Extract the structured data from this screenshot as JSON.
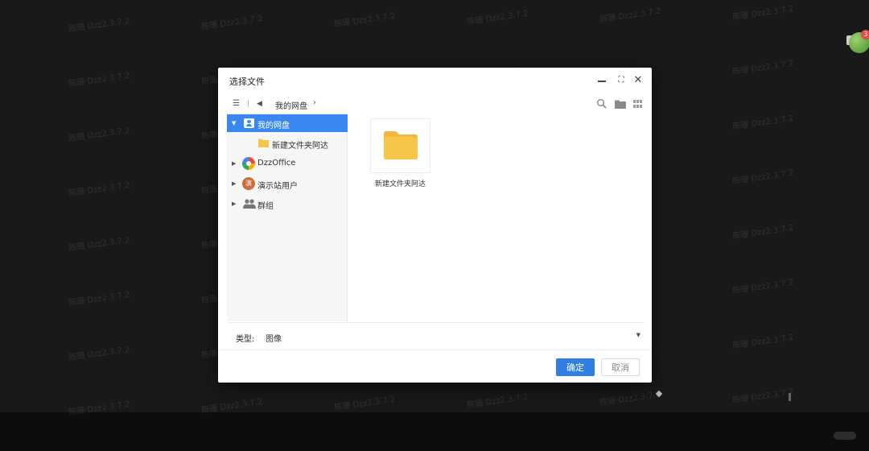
{
  "watermark": {
    "text": "陈珊 Dzz2.3.7.2"
  },
  "corner": {
    "badge": "3"
  },
  "dialog": {
    "title": "选择文件",
    "window_controls": {
      "minimize": "",
      "maximize": "⛶",
      "close": "✕"
    }
  },
  "toolbar": {
    "menu_icon": "menu-icon",
    "separator": "|",
    "back_icon": "back-arrow-icon",
    "breadcrumb": "我的网盘",
    "breadcrumb_chevron": "›",
    "right_icons": [
      "search-icon",
      "folder-icon",
      "grid-view-icon"
    ]
  },
  "sidebar": {
    "items": [
      {
        "label": "我的网盘",
        "icon": "user-disk-icon",
        "selected": true,
        "expanded": true
      },
      {
        "label": "新建文件夹阿达",
        "icon": "folder-icon",
        "selected": false
      },
      {
        "label": "DzzOffice",
        "icon": "dzzoffice-logo-icon",
        "selected": false
      },
      {
        "label": "演示站用户",
        "icon": "user-avatar",
        "avatar_text": "演",
        "selected": false
      },
      {
        "label": "群组",
        "icon": "group-icon",
        "selected": false
      }
    ]
  },
  "content": {
    "files": [
      {
        "name": "新建文件夹阿达",
        "icon": "folder-icon"
      }
    ]
  },
  "type_filter": {
    "label": "类型:",
    "value": "图像"
  },
  "footer": {
    "ok_label": "确定",
    "cancel_label": "取消"
  },
  "colors": {
    "accent": "#3b87f0",
    "folder": "#f7c54a",
    "ok_button": "#2f7ee8",
    "backdrop": "#191919"
  }
}
